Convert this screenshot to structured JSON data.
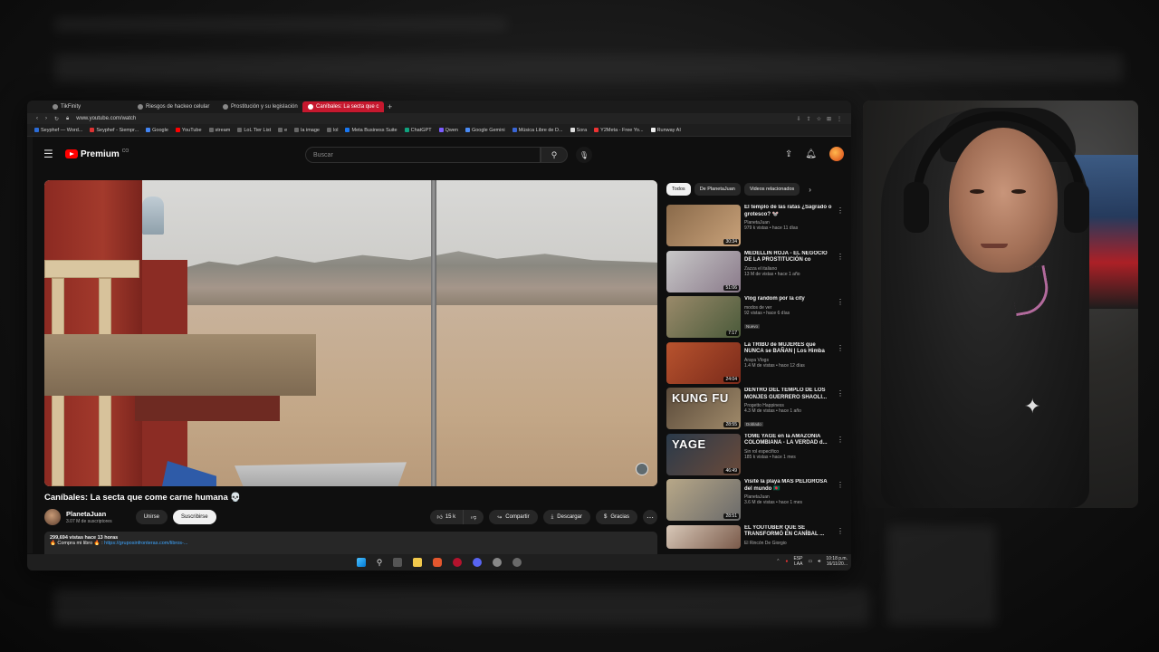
{
  "browser": {
    "tabs": [
      {
        "label": "TikFinity",
        "active": false
      },
      {
        "label": "Riesgos de hackeo celular",
        "active": false
      },
      {
        "label": "Prostitución y su legislación",
        "active": false
      },
      {
        "label": "Caníbales: La secta que c",
        "active": true
      }
    ],
    "url": "www.youtube.com/watch",
    "bookmarks": [
      "Seyphef — Word...",
      "Seyphef - Siempr...",
      "Google",
      "YouTube",
      "stream",
      "LoL Tier List",
      "e",
      "la image",
      "lol",
      "Meta Business Suite",
      "ChatGPT",
      "Qwen",
      "Google Gemini",
      "Música Libre de D...",
      "Sora",
      "Y2Meta - Free Yo...",
      "Runway AI"
    ]
  },
  "youtube": {
    "logo_text": "Premium",
    "logo_region": "CO",
    "search_placeholder": "Buscar"
  },
  "video": {
    "title": "Caníbales: La secta que come carne humana 💀",
    "channel": "PlanetaJuan",
    "subscribers": "3.07 M de suscriptores",
    "join_label": "Unirse",
    "subscribe_label": "Suscribirse",
    "likes": "15 k",
    "share_label": "Compartir",
    "download_label": "Descargar",
    "thanks_label": "Gracias",
    "views_time": "299,694 vistas  hace 13 horas",
    "desc_prefix": "🔥 Compra mi libro 🔥 : ",
    "desc_link": "https://gruposinfronteras.com/libros-..."
  },
  "chips": [
    "Todos",
    "De PlanetaJuan",
    "Videos relacionados"
  ],
  "related": [
    {
      "title": "El templo de las ratas ¿Sagrado o grotesco? 🐭",
      "channel": "PlanetaJuan",
      "meta": "979 k vistas • hace 11 días",
      "duration": "30:34",
      "badge": "",
      "thumb_word": "",
      "c1": "#8a6a4a",
      "c2": "#c9a27a"
    },
    {
      "title": "MEDELLÍN ROJA - EL NEGOCIO DE LA PROSTITUCIÓN co",
      "channel": "Zazza el italiano",
      "meta": "13 M de vistas • hace 1 año",
      "duration": "51:06",
      "badge": "",
      "thumb_word": "",
      "c1": "#c8c8c8",
      "c2": "#8a7a8a"
    },
    {
      "title": "Vlog random por la city",
      "channel": "modos de ver",
      "meta": "92 vistas • hace 6 días",
      "duration": "7:17",
      "badge": "Nuevo",
      "thumb_word": "",
      "c1": "#9a8a6a",
      "c2": "#4a5a3a"
    },
    {
      "title": "La TRIBU de MUJERES que NUNCA se BAÑAN | Los Himba",
      "channel": "Araya Vlogs",
      "meta": "1.4 M de vistas • hace 12 días",
      "duration": "24:04",
      "badge": "",
      "thumb_word": "",
      "c1": "#b8532e",
      "c2": "#7a2a1a"
    },
    {
      "title": "DENTRO DEL TEMPLO DE LOS MONJES GUERRERO SHAOLI...",
      "channel": "Progetto Happiness",
      "meta": "4.3 M de vistas • hace 1 año",
      "duration": "28:55",
      "badge": "Doblado",
      "thumb_word": "KUNG FU",
      "c1": "#5a4a3a",
      "c2": "#a08a6a"
    },
    {
      "title": "TOME YAGÉ en la AMAZONIA COLOMBIANA - LA VERDAD d...",
      "channel": "Sin rol específico",
      "meta": "185 k vistas • hace 1 mes",
      "duration": "46:49",
      "badge": "",
      "thumb_word": "YAGE",
      "c1": "#2a3a4a",
      "c2": "#6a4a3a"
    },
    {
      "title": "Visité la playa MÁS PELIGROSA del mundo 🇧🇩",
      "channel": "PlanetaJuan",
      "meta": "3.6 M de vistas • hace 1 mes",
      "duration": "28:51",
      "badge": "",
      "thumb_word": "",
      "c1": "#b8a888",
      "c2": "#6a6a6a"
    },
    {
      "title": "EL YOUTUBER QUE SE TRANSFORMÓ EN CANÍBAL ...",
      "channel": "El Rincón De Giorgio",
      "meta": "",
      "duration": "",
      "badge": "",
      "thumb_word": "",
      "c1": "#d8c8b8",
      "c2": "#7a5a4a"
    }
  ],
  "taskbar": {
    "lang_top": "ESP",
    "lang_bottom": "LAA",
    "time": "10:18 p.m.",
    "date": "16/11/20..."
  },
  "colors": {
    "accent": "#ff0000",
    "link": "#3ea6ff",
    "tab_active": "#c6182e"
  }
}
